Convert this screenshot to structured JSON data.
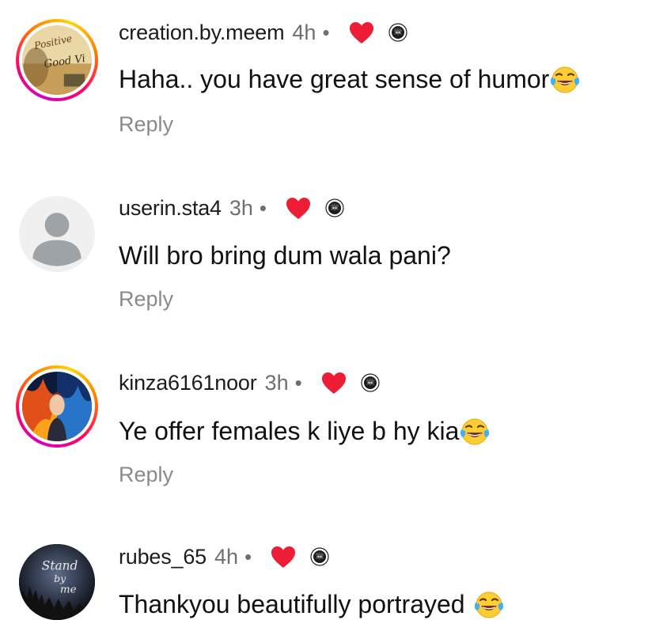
{
  "comments": [
    {
      "username": "creation.by.meem",
      "time": "4h",
      "separator": "•",
      "text": "Haha.. you have great sense of humor",
      "reply_label": "Reply",
      "avatar_text_1": "Positive",
      "avatar_text_2": "Good Vi"
    },
    {
      "username": "userin.sta4",
      "time": "3h",
      "separator": "•",
      "text": "Will bro bring dum wala pani?",
      "reply_label": "Reply"
    },
    {
      "username": "kinza6161noor",
      "time": "3h",
      "separator": "•",
      "text": "Ye offer females k liye b hy kia",
      "reply_label": "Reply"
    },
    {
      "username": "rubes_65",
      "time": "4h",
      "separator": "•",
      "text": "Thankyou beautifully portrayed",
      "avatar_text_1": "Stand",
      "avatar_text_2": "by",
      "avatar_text_3": "me"
    }
  ],
  "icons": {
    "liked_by_creator": "red-heart-icon",
    "creator_badge": "creator-avatar-icon",
    "emoji": "face-with-tears-of-joy"
  },
  "colors": {
    "heart": "#ee1d36",
    "muted": "#8a8a8a"
  }
}
